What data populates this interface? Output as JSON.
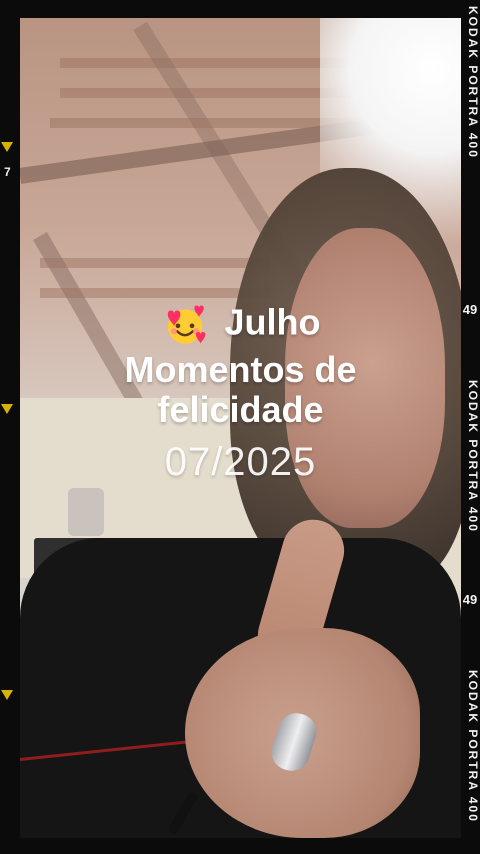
{
  "overlay": {
    "emoji_name": "smiling-face-with-hearts-icon",
    "line1": "Julho",
    "line2": "Momentos de",
    "line3": "felicidade",
    "date": "07/2025"
  },
  "film_border": {
    "brand_top": "KODAK PORTRA 400",
    "brand_mid": "KODAK PORTRA 400",
    "brand_low": "KODAK PORTRA 400",
    "brand_bottom": "KODAK PORTRA 400",
    "frame_number_top": "49",
    "frame_number_mid": "49",
    "left_marker": "7"
  }
}
